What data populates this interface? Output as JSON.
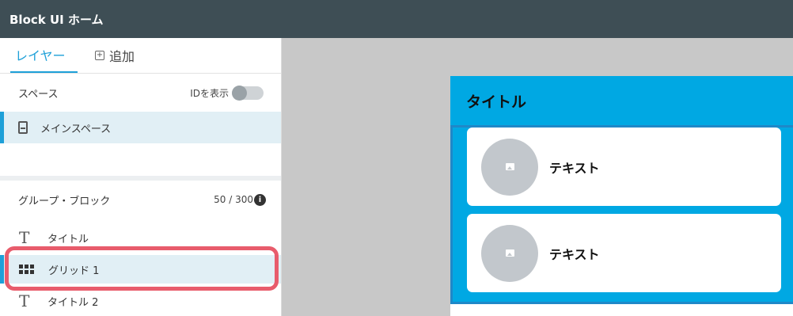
{
  "app": {
    "title": "Block UI ホーム"
  },
  "tabs": [
    {
      "label": "レイヤー",
      "active": true
    },
    {
      "label": "追加",
      "icon": "plus-box-icon",
      "active": false
    }
  ],
  "space_section": {
    "label": "スペース",
    "toggle_label": "IDを表示",
    "toggle_on": false,
    "items": [
      {
        "label": "メインスペース",
        "icon": "phone-icon",
        "selected": true
      }
    ]
  },
  "group_section": {
    "label": "グループ・ブロック",
    "count": "50 / 300",
    "info_icon": "info-icon",
    "items": [
      {
        "label": "タイトル",
        "icon": "text-icon",
        "selected": false
      },
      {
        "label": "グリッド 1",
        "icon": "grid-icon",
        "selected": true
      },
      {
        "label": "タイトル 2",
        "icon": "text-icon",
        "selected": false
      }
    ]
  },
  "canvas": {
    "title": "タイトル",
    "cards": [
      {
        "label": "テキスト",
        "icon": "image-icon"
      },
      {
        "label": "テキスト",
        "icon": "image-icon"
      }
    ]
  },
  "colors": {
    "topbar": "#3e4e55",
    "accent": "#1ea0d8",
    "canvas_bg": "#00a8e3",
    "highlight": "#e85c6c",
    "selected_bg": "#e1eff5"
  }
}
